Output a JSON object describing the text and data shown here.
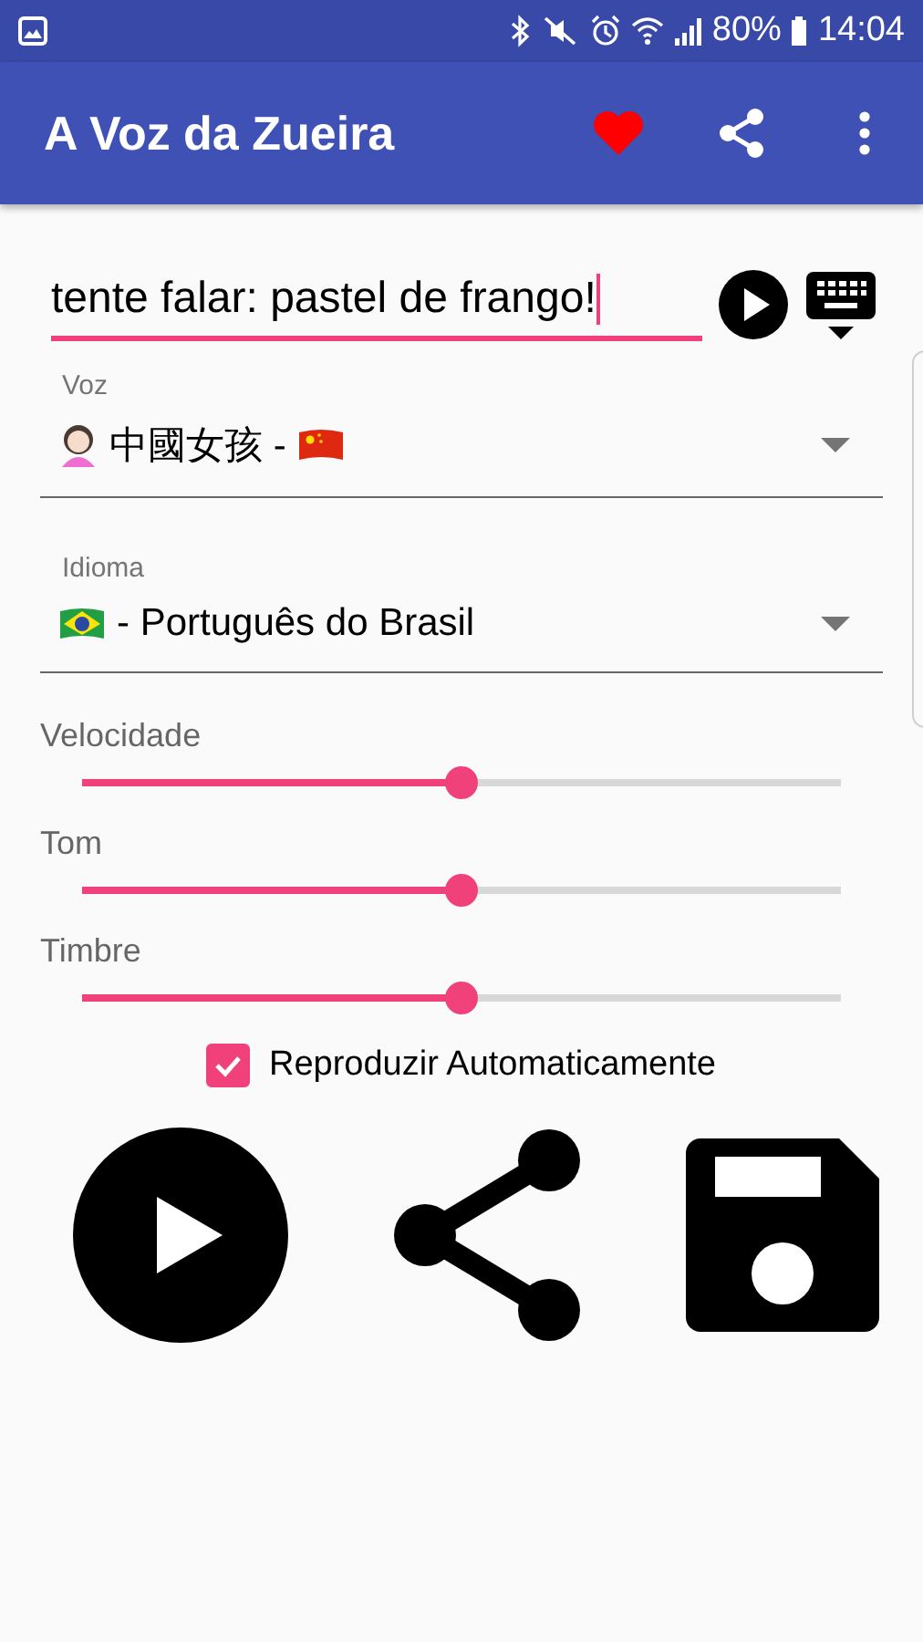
{
  "status_bar": {
    "battery": "80%",
    "time": "14:04"
  },
  "app_bar": {
    "title": "A Voz da Zueira"
  },
  "text_input": {
    "value": "tente falar: pastel de frango!"
  },
  "dropdowns": [
    {
      "label": "Voz",
      "value": "中國女孩 -",
      "kind": "voice"
    },
    {
      "label": "Idioma",
      "value": "- Português do Brasil",
      "kind": "language"
    }
  ],
  "sliders": [
    {
      "label": "Velocidade",
      "level": 0.5
    },
    {
      "label": "Tom",
      "level": 0.5
    },
    {
      "label": "Timbre",
      "level": 0.5
    }
  ],
  "autoplay": {
    "label": "Reproduzir Automaticamente",
    "checked": true
  }
}
